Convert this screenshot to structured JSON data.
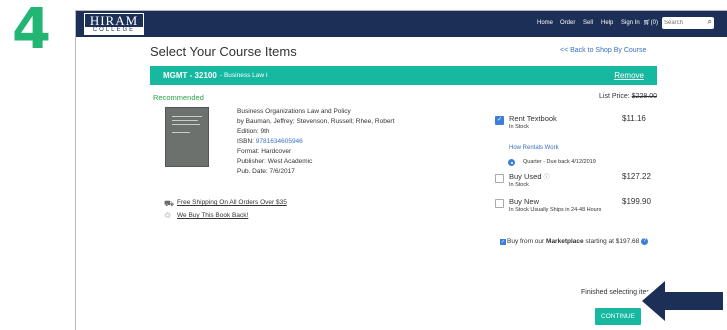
{
  "step_number": "4",
  "header": {
    "logo_main": "HIRAM",
    "logo_sub": "COLLEGE",
    "nav": [
      "Home",
      "Order",
      "Sell",
      "Help",
      "Sign In"
    ],
    "cart_label": "(0)",
    "search_placeholder": "Search"
  },
  "page": {
    "title": "Select Your Course Items",
    "back_link": "<< Back to Shop By Course"
  },
  "course": {
    "code": "MGMT - 32100",
    "name": "- Business Law I",
    "remove_label": "Remove"
  },
  "recommended_label": "Recommended",
  "list_price": {
    "label": "List Price:",
    "value": "$228.00"
  },
  "book": {
    "title": "Business Organizations Law and Policy",
    "authors": "by Bauman, Jeffrey; Stevenson, Russell; Rhee, Robert",
    "edition": "Edition: 9th",
    "isbn_label": "ISBN:",
    "isbn": "9781634605946",
    "format": "Format: Hardcover",
    "publisher": "Publisher: West Academic",
    "pub_date": "Pub. Date: 7/6/2017"
  },
  "perks": {
    "shipping": "Free Shipping On All Orders Over $35",
    "buyback": "We Buy This Book Back!"
  },
  "options": {
    "rent": {
      "label": "Rent Textbook",
      "stock": "In Stock",
      "price": "$11.16",
      "how_link": "How Rentals Work",
      "term": "Quarter - Due back 4/12/2019",
      "checked": true
    },
    "used": {
      "label": "Buy Used",
      "stock": "In Stock",
      "price": "$127.22",
      "checked": false
    },
    "new": {
      "label": "Buy New",
      "stock": "In Stock Usually Ships in 24-48 Hours",
      "price": "$199.90",
      "checked": false
    }
  },
  "marketplace": {
    "prefix": "Buy from our",
    "link": "Marketplace",
    "suffix": "starting at $197.68"
  },
  "footer": {
    "finished_text": "Finished selecting items?",
    "continue_label": "CONTINUE"
  },
  "colors": {
    "step_green": "#22b573",
    "header_navy": "#1c2f57",
    "teal": "#16b8a0",
    "arrow_navy": "#1c2f57",
    "link_blue": "#3a6fc2"
  }
}
